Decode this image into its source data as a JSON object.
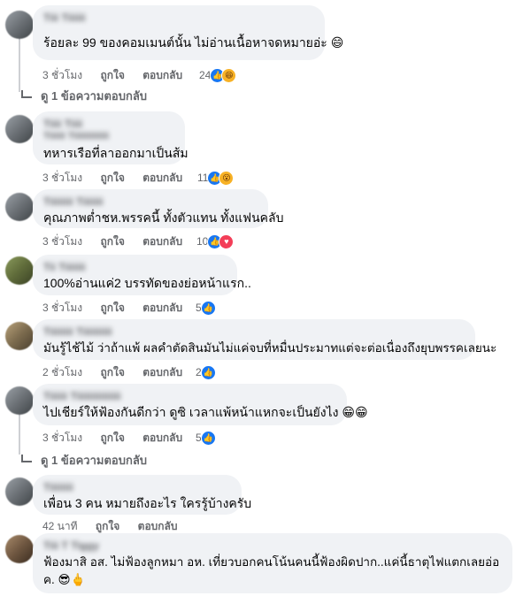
{
  "comments": [
    {
      "name": "Tiii Tiiiiii",
      "subname": "",
      "text": "ร้อยละ 99 ของคอมเมนต์นั้น ไม่อ่านเนื้อหาจดหมายอ่ะ 😄",
      "time": "3 ชั่วโมง",
      "like": "ถูกใจ",
      "reply": "ตอบกลับ",
      "reaction_count": "24",
      "reactions": [
        "like",
        "haha"
      ],
      "replies_label": "ดู 1 ข้อความตอบกลับ"
    },
    {
      "name": "Tiiii Tiiii",
      "subname": "Tiiiiii Tiiiiiiiiiiiii",
      "text": "ทหารเรือที่ลาออกมาเป็นส้ม",
      "time": "3 ชั่วโมง",
      "like": "ถูกใจ",
      "reply": "ตอบกลับ",
      "reaction_count": "11",
      "reactions": [
        "like",
        "wow"
      ]
    },
    {
      "name": "Tiiiiiiii Tiiiiiii",
      "subname": "",
      "text": "คุณภาพต่ำชห.พรรคนี้ ทั้งตัวแทน ทั้งแฟนคลับ",
      "time": "3 ชั่วโมง",
      "like": "ถูกใจ",
      "reply": "ตอบกลับ",
      "reaction_count": "10",
      "reactions": [
        "like",
        "love"
      ]
    },
    {
      "name": "Tii Tiiiiiii",
      "subname": "",
      "text": "100%อ่านแค่2 บรรทัดของย่อหน้าแรก..",
      "time": "3 ชั่วโมง",
      "like": "ถูกใจ",
      "reply": "ตอบกลับ",
      "reaction_count": "5",
      "reactions": [
        "like"
      ]
    },
    {
      "name": "Tiiiiiiii Tiiiiiiiiii",
      "subname": "",
      "text": "มันรู้ไช้ไม้ ว่าถ้าแพ้ ผลคำตัดสินมันไม่แค่จบที่หมื่นประมาทแต่จะต่อเนื่องถึงยุบพรรคเลยนะ",
      "time": "2 ชั่วโมง",
      "like": "ถูกใจ",
      "reply": "ตอบกลับ",
      "reaction_count": "2",
      "reactions": [
        "like"
      ]
    },
    {
      "name": "Tiiiiii Tiiiiiiiiiiiiiii",
      "subname": "",
      "text": "ไปเชียร์ให้ฟ้องกันดีกว่า ดูซิ เวลาแพ้หน้าแหกจะเป็นยังไง 😁😁",
      "time": "3 ชั่วโมง",
      "like": "ถูกใจ",
      "reply": "ตอบกลับ",
      "reaction_count": "5",
      "reactions": [
        "like"
      ],
      "replies_label": "ดู 1 ข้อความตอบกลับ"
    },
    {
      "name": "Tiiiiiiii",
      "subname": "",
      "text": "เพื่อน 3 คน หมายถึงอะไร ใครรู้บ้างครับ",
      "time": "42 นาที",
      "like": "ถูกใจ",
      "reply": "ตอบกลับ",
      "reaction_count": "",
      "reactions": []
    },
    {
      "name": "Tiii T Tiggy",
      "subname": "",
      "text": "ฟ้องมาสิ อส. ไม่ฟ้องลูกหมา อห. เที่ยวบอกคนโน้นคนนี้ฟ้องผิดปาก..แค่นี้ธาตุไฟแตกเลยอ่อ ค. 😎🖕",
      "time": "",
      "like": "",
      "reply": "",
      "reaction_count": "",
      "reactions": []
    }
  ],
  "icons": {
    "like": "👍",
    "haha": "😆",
    "wow": "😮",
    "love": "♥"
  },
  "colors": {
    "bubble": "#f0f2f5",
    "like_blue": "#1877f2",
    "love_red": "#f33e58",
    "secondary_text": "#65676b"
  }
}
